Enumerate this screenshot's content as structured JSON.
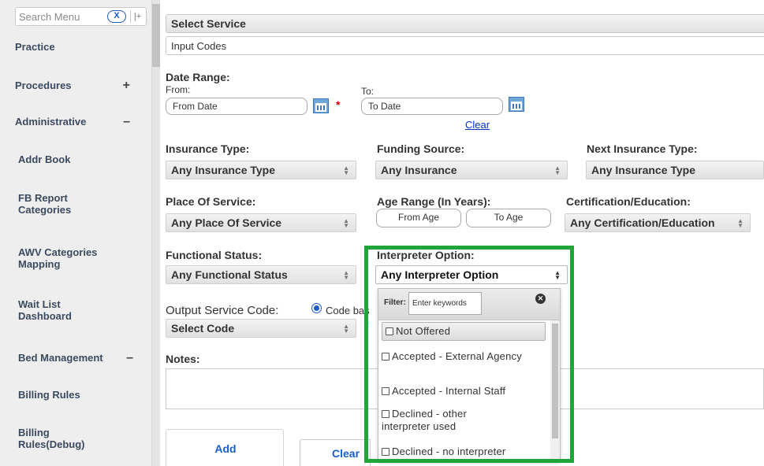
{
  "sidebar": {
    "search_placeholder": "Search Menu",
    "clear_label": "X",
    "collapse_label": "|+",
    "items": [
      {
        "label": "Practice",
        "toggle": ""
      },
      {
        "label": "Procedures",
        "toggle": "+"
      },
      {
        "label": "Administrative",
        "toggle": "–"
      },
      {
        "label": "Addr Book",
        "toggle": ""
      },
      {
        "label": "FB Report Categories",
        "toggle": ""
      },
      {
        "label": "AWV Categories Mapping",
        "toggle": ""
      },
      {
        "label": "Wait List Dashboard",
        "toggle": ""
      },
      {
        "label": "Bed Management",
        "toggle": "–"
      },
      {
        "label": "Billing Rules",
        "toggle": ""
      },
      {
        "label": "Billing Rules(Debug)",
        "toggle": ""
      }
    ]
  },
  "main": {
    "title": "Select Service",
    "input_codes": "Input Codes",
    "date_range": {
      "label": "Date Range:",
      "from_label": "From:",
      "to_label": "To:",
      "from_value": "From Date",
      "to_value": "To Date",
      "required": "*",
      "clear_link": "Clear"
    },
    "insurance_type": {
      "label": "Insurance Type:",
      "value": "Any Insurance Type"
    },
    "funding_source": {
      "label": "Funding Source:",
      "value": "Any Insurance"
    },
    "next_insurance_type": {
      "label": "Next Insurance Type:",
      "value": "Any Insurance Type"
    },
    "place_of_service": {
      "label": "Place Of Service:",
      "value": "Any Place Of Service"
    },
    "age_range": {
      "label": "Age Range (In Years):",
      "from": "From Age",
      "to": "To Age"
    },
    "certification": {
      "label": "Certification/Education:",
      "value": "Any Certification/Education"
    },
    "functional_status": {
      "label": "Functional Status:",
      "value": "Any Functional Status"
    },
    "interpreter": {
      "label": "Interpreter Option:",
      "value": "Any Interpreter Option"
    },
    "output_service_code": {
      "label": "Output Service Code:",
      "radio_label": "Code bas",
      "select_value": "Select Code",
      "required": "*"
    },
    "notes_label": "Notes:",
    "add_button": "Add",
    "clear_button": "Clear"
  },
  "interpreter_dropdown": {
    "filter_label": "Filter:",
    "filter_placeholder": "Enter keywords",
    "close_label": "✕",
    "options": [
      {
        "label": "Not Offered",
        "checked": false
      },
      {
        "label": "Accepted - External Agency",
        "checked": false
      },
      {
        "label": "Accepted - Internal Staff",
        "checked": false
      },
      {
        "label": "Declined - other interpreter used",
        "checked": false
      },
      {
        "label": "Declined - no interpreter",
        "checked": false
      }
    ]
  },
  "colors": {
    "highlight_box": "#21a539",
    "link": "#0033cc",
    "required": "#d40000",
    "accent": "#1a5cc8"
  }
}
